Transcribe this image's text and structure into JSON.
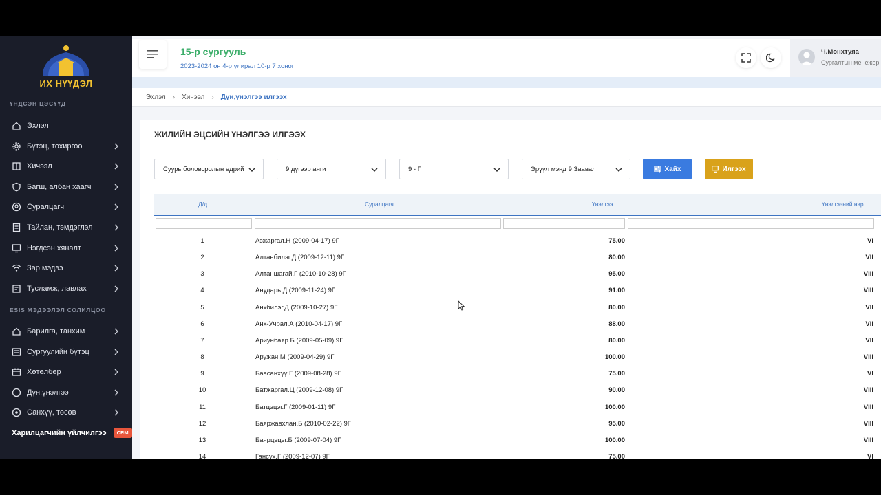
{
  "sidebar": {
    "logo_text": "ИХ НҮҮДЭЛ",
    "section1": "ҮНДСЭН ЦЭСҮҮД",
    "items1": [
      {
        "label": "Эхлэл",
        "icon": "home-icon"
      },
      {
        "label": "Бүтэц, тохиргоо",
        "icon": "gear-icon"
      },
      {
        "label": "Хичээл",
        "icon": "book-icon"
      },
      {
        "label": "Багш, албан хаагч",
        "icon": "shield-icon"
      },
      {
        "label": "Суралцагч",
        "icon": "user-circle-icon"
      },
      {
        "label": "Тайлан, тэмдэглэл",
        "icon": "report-icon"
      },
      {
        "label": "Нэгдсэн хяналт",
        "icon": "monitor-icon"
      },
      {
        "label": "Зар мэдээ",
        "icon": "wifi-icon"
      },
      {
        "label": "Тусламж, лавлах",
        "icon": "help-icon"
      }
    ],
    "section2": "ESIS МЭДЭЭЛЭЛ СОЛИЛЦОО",
    "items2": [
      {
        "label": "Барилга, танхим",
        "icon": "building-icon"
      },
      {
        "label": "Сургуулийн бүтэц",
        "icon": "structure-icon"
      },
      {
        "label": "Хөтөлбөр",
        "icon": "program-icon"
      },
      {
        "label": "Дүн,үнэлгээ",
        "icon": "grade-icon"
      },
      {
        "label": "Санхүү, төсөв",
        "icon": "finance-icon"
      }
    ],
    "crm_label": "Харилцагчийн үйлчилгээ",
    "crm_badge": "CRM"
  },
  "header": {
    "school": "15-р сургууль",
    "subtitle": "2023-2024 он 4-р улирал 10-р 7 хоног",
    "user_name": "Ч.Мөнхтуяа",
    "user_role": "Сургалтын менежер"
  },
  "breadcrumb": {
    "home": "Эхлэл",
    "section": "Хичээл",
    "current": "Дүн,үнэлгээ илгээх"
  },
  "card": {
    "title": "ЖИЛИЙН ЭЦСИЙН ҮНЭЛГЭЭ ИЛГЭЭХ",
    "filters": {
      "level": "Суурь боловсролын өдрийн",
      "grade": "9 дүгээр анги",
      "class": "9 - Г",
      "subject": "Эрүүл мэнд 9 Заавал"
    },
    "search_label": "Хайх",
    "send_label": "Илгээх"
  },
  "table": {
    "columns": [
      "Д/д",
      "Суралцагч",
      "Үнэлгээ",
      "Үнэлгээний нэр"
    ],
    "rows": [
      {
        "num": "1",
        "name": "Азжаргал.Н (2009-04-17) 9Г",
        "score": "75.00",
        "grade": "VI"
      },
      {
        "num": "2",
        "name": "Алтанбилэг.Д (2009-12-11) 9Г",
        "score": "80.00",
        "grade": "VII"
      },
      {
        "num": "3",
        "name": "Алтаншагай.Г (2010-10-28) 9Г",
        "score": "95.00",
        "grade": "VIII"
      },
      {
        "num": "4",
        "name": "Анударь.Д (2009-11-24) 9Г",
        "score": "91.00",
        "grade": "VIII"
      },
      {
        "num": "5",
        "name": "Анхбилэг.Д (2009-10-27) 9Г",
        "score": "80.00",
        "grade": "VII"
      },
      {
        "num": "6",
        "name": "Анх-Учрал.А (2010-04-17) 9Г",
        "score": "88.00",
        "grade": "VII"
      },
      {
        "num": "7",
        "name": "Ариунбаяр.Б (2009-05-09) 9Г",
        "score": "80.00",
        "grade": "VII"
      },
      {
        "num": "8",
        "name": "Аружан.М (2009-04-29) 9Г",
        "score": "100.00",
        "grade": "VIII"
      },
      {
        "num": "9",
        "name": "Баасанхүү.Г (2009-08-28) 9Г",
        "score": "75.00",
        "grade": "VI"
      },
      {
        "num": "10",
        "name": "Батжаргал.Ц (2009-12-08) 9Г",
        "score": "90.00",
        "grade": "VIII"
      },
      {
        "num": "11",
        "name": "Батцэцэг.Г (2009-01-11) 9Г",
        "score": "100.00",
        "grade": "VIII"
      },
      {
        "num": "12",
        "name": "Баяржавхлан.Б (2010-02-22) 9Г",
        "score": "95.00",
        "grade": "VIII"
      },
      {
        "num": "13",
        "name": "Баярцэцэг.Б (2009-07-04) 9Г",
        "score": "100.00",
        "grade": "VIII"
      },
      {
        "num": "14",
        "name": "Гансүх.Г (2009-12-07) 9Г",
        "score": "75.00",
        "grade": "VI"
      }
    ]
  },
  "colors": {
    "sidebar_bg": "#1a1d29",
    "title_green": "#3cae6a",
    "accent_blue": "#3e74c2",
    "search_btn": "#3a7be0",
    "send_btn": "#d9a21b",
    "crm_badge": "#e8563c"
  }
}
